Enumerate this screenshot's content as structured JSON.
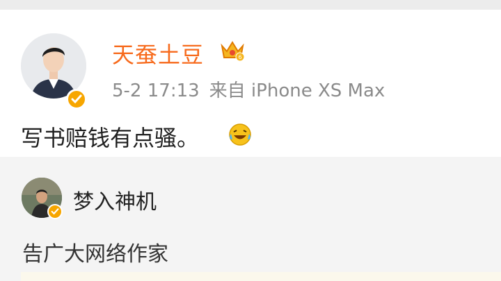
{
  "post": {
    "author": "天蚕土豆",
    "time": "5-2 17:13",
    "source": "来自 iPhone XS Max",
    "text": "写书赔钱有点骚。",
    "crown_level": "6",
    "emoji": "laugh-cry-emoji"
  },
  "repost": {
    "author": "梦入神机",
    "text": "告广大网络作家"
  },
  "colors": {
    "author_orange": "#f76a1c",
    "meta_gray": "#8a8a8a",
    "verified_gold": "#f7a600"
  }
}
